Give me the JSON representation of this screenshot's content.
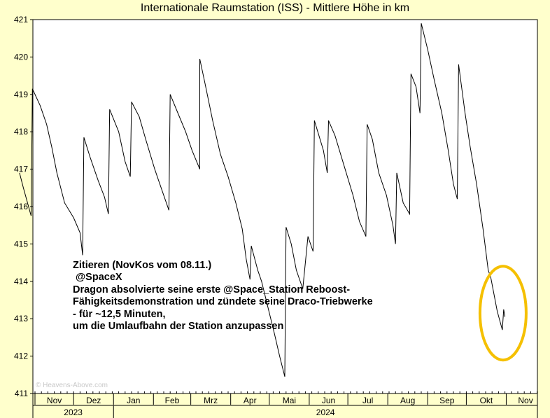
{
  "chart_data": {
    "type": "line",
    "title": "Internationale Raumstation (ISS) - Mittlere Höhe in km",
    "xlabel": "",
    "ylabel": "",
    "ylim": [
      411,
      421
    ],
    "yticks": [
      411,
      412,
      413,
      414,
      415,
      416,
      417,
      418,
      419,
      420,
      421
    ],
    "x_month_labels": [
      "Nov",
      "Dez",
      "Jan",
      "Feb",
      "Mrz",
      "Apr",
      "Mai",
      "Jun",
      "Jul",
      "Aug",
      "Sep",
      "Okt",
      "Nov"
    ],
    "x_year_labels": [
      "2023",
      "2024"
    ],
    "grid": false,
    "line_color": "#000000",
    "background_color": "#ffffcc",
    "plot_background": "#ffffff",
    "series": [
      {
        "values": [
          [
            "2023-10-20",
            416.9
          ],
          [
            "2023-10-23",
            416.5
          ],
          [
            "2023-10-27",
            416.0
          ],
          [
            "2023-10-29",
            415.75
          ],
          [
            "2023-10-30",
            419.15
          ],
          [
            "2023-11-05",
            418.7
          ],
          [
            "2023-11-10",
            418.2
          ],
          [
            "2023-11-14",
            417.6
          ],
          [
            "2023-11-18",
            416.9
          ],
          [
            "2023-11-24",
            416.1
          ],
          [
            "2023-12-01",
            415.7
          ],
          [
            "2023-12-06",
            415.3
          ],
          [
            "2023-12-08",
            414.7
          ],
          [
            "2023-12-09",
            417.85
          ],
          [
            "2023-12-14",
            417.3
          ],
          [
            "2023-12-20",
            416.7
          ],
          [
            "2023-12-25",
            416.25
          ],
          [
            "2023-12-28",
            415.8
          ],
          [
            "2023-12-29",
            418.6
          ],
          [
            "2024-01-05",
            418.0
          ],
          [
            "2024-01-10",
            417.2
          ],
          [
            "2024-01-14",
            416.8
          ],
          [
            "2024-01-15",
            418.8
          ],
          [
            "2024-01-21",
            418.4
          ],
          [
            "2024-01-26",
            417.8
          ],
          [
            "2024-02-02",
            417.0
          ],
          [
            "2024-02-07",
            416.5
          ],
          [
            "2024-02-13",
            415.9
          ],
          [
            "2024-02-14",
            419.0
          ],
          [
            "2024-02-20",
            418.5
          ],
          [
            "2024-02-26",
            418.0
          ],
          [
            "2024-03-02",
            417.5
          ],
          [
            "2024-03-08",
            417.0
          ],
          [
            "2024-03-08",
            419.95
          ],
          [
            "2024-03-12",
            419.3
          ],
          [
            "2024-03-18",
            418.3
          ],
          [
            "2024-03-24",
            417.4
          ],
          [
            "2024-03-30",
            416.8
          ],
          [
            "2024-04-05",
            416.1
          ],
          [
            "2024-04-10",
            415.4
          ],
          [
            "2024-04-13",
            414.6
          ],
          [
            "2024-04-16",
            414.05
          ],
          [
            "2024-04-17",
            414.95
          ],
          [
            "2024-04-22",
            414.3
          ],
          [
            "2024-04-25",
            414.0
          ],
          [
            "2024-04-30",
            413.3
          ],
          [
            "2024-05-05",
            412.6
          ],
          [
            "2024-05-09",
            412.0
          ],
          [
            "2024-05-13",
            411.45
          ],
          [
            "2024-05-14",
            415.45
          ],
          [
            "2024-05-18",
            415.0
          ],
          [
            "2024-05-22",
            414.3
          ],
          [
            "2024-05-27",
            413.8
          ],
          [
            "2024-05-31",
            415.2
          ],
          [
            "2024-06-04",
            414.8
          ],
          [
            "2024-06-05",
            418.3
          ],
          [
            "2024-06-12",
            417.5
          ],
          [
            "2024-06-15",
            416.9
          ],
          [
            "2024-06-16",
            418.3
          ],
          [
            "2024-06-21",
            417.9
          ],
          [
            "2024-06-28",
            417.1
          ],
          [
            "2024-07-05",
            416.3
          ],
          [
            "2024-07-10",
            415.6
          ],
          [
            "2024-07-15",
            415.2
          ],
          [
            "2024-07-16",
            418.2
          ],
          [
            "2024-07-20",
            417.8
          ],
          [
            "2024-07-25",
            416.9
          ],
          [
            "2024-07-31",
            416.3
          ],
          [
            "2024-08-05",
            415.5
          ],
          [
            "2024-08-07",
            415.0
          ],
          [
            "2024-08-08",
            416.9
          ],
          [
            "2024-08-13",
            416.1
          ],
          [
            "2024-08-18",
            415.8
          ],
          [
            "2024-08-19",
            419.55
          ],
          [
            "2024-08-23",
            419.2
          ],
          [
            "2024-08-26",
            418.5
          ],
          [
            "2024-08-27",
            420.9
          ],
          [
            "2024-09-01",
            420.2
          ],
          [
            "2024-09-06",
            419.4
          ],
          [
            "2024-09-12",
            418.5
          ],
          [
            "2024-09-17",
            417.5
          ],
          [
            "2024-09-21",
            416.6
          ],
          [
            "2024-09-24",
            416.2
          ],
          [
            "2024-09-25",
            419.8
          ],
          [
            "2024-09-30",
            418.5
          ],
          [
            "2024-10-04",
            417.6
          ],
          [
            "2024-10-09",
            416.6
          ],
          [
            "2024-10-14",
            415.4
          ],
          [
            "2024-10-18",
            414.3
          ],
          [
            "2024-10-20",
            414.1
          ],
          [
            "2024-10-25",
            413.2
          ],
          [
            "2024-10-29",
            412.7
          ],
          [
            "2024-10-30",
            413.25
          ],
          [
            "2024-10-31",
            413.05
          ]
        ]
      }
    ],
    "annotation_lines": [
      "Zitieren (NovKos vom 08.11.)",
      " @SpaceX",
      "Dragon absolvierte seine erste @Space_Station Reboost-",
      "Fähigkeitsdemonstration und zündete seine Draco-Triebwerke",
      "- für ~12,5 Minuten,",
      "um die Umlaufbahn der Station anzupassen"
    ],
    "highlight_color": "#f5c000",
    "watermark": "© Heavens-Above.com"
  }
}
